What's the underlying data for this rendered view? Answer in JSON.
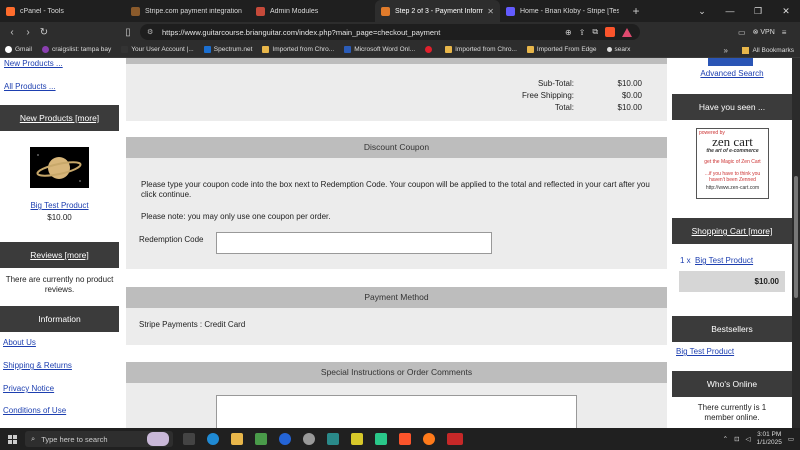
{
  "browser": {
    "tabs": [
      {
        "label": "cPanel - Tools",
        "color": "#ff6c2c"
      },
      {
        "label": "Stripe.com payment integration mo",
        "color": "#8a5a2b"
      },
      {
        "label": "Admin Modules",
        "color": "#c64a3a"
      },
      {
        "label": "Step 2 of 3 - Payment Informati",
        "color": "#e07b2b"
      },
      {
        "label": "Home - Brian Kloby - Stripe [Test]",
        "color": "#635bff"
      }
    ],
    "new_tab": "+",
    "url": "https://www.guitarcourse.brianguitar.com/index.php?main_page=checkout_payment",
    "vpn": "VPN",
    "bookmarks": [
      "Gmail",
      "craigslist: tampa bay",
      "Your User Account |...",
      "Spectrum.net",
      "Imported from Chro...",
      "Microsoft Word Onl...",
      "Imported from Chro...",
      "Imported From Edge",
      "searx"
    ],
    "bookmark_more": "»",
    "all_bookmarks": "All Bookmarks"
  },
  "left_sidebar": {
    "link_new_products": "New Products ...",
    "link_all_products": "All Products ...",
    "new_products_header": "New Products  [more]",
    "product_name": "Big Test Product",
    "product_price": "$10.00",
    "reviews_header": "Reviews  [more]",
    "reviews_text": "There are currently no product reviews.",
    "information_header": "Information",
    "info_links": [
      "About Us",
      "Shipping & Returns",
      "Privacy Notice",
      "Conditions of Use"
    ]
  },
  "center": {
    "totals": [
      {
        "label": "Sub-Total:",
        "value": "$10.00"
      },
      {
        "label": "Free Shipping:",
        "value": "$0.00"
      },
      {
        "label": "Total:",
        "value": "$10.00"
      }
    ],
    "coupon_header": "Discount Coupon",
    "coupon_instructions": "Please type your coupon code into the box next to Redemption Code. Your coupon will be applied to the total and reflected in your cart after you click continue.",
    "coupon_note": "Please note: you may only use one coupon per order.",
    "redemption_label": "Redemption Code",
    "redemption_value": "",
    "payment_header": "Payment Method",
    "payment_method": "Stripe Payments : Credit Card",
    "instructions_header": "Special Instructions or Order Comments",
    "comments_value": ""
  },
  "right_sidebar": {
    "advanced_search": "Advanced Search",
    "have_you_seen_header": "Have you seen ...",
    "zencart": {
      "powered_by": "powered by",
      "brand": "zen cart",
      "tagline": "the art of e-commerce",
      "magic": "get the Magic of Zen Cart",
      "zenned": "...if you have to think you haven't been Zenned",
      "url": "http://www.zen-cart.com"
    },
    "cart_header": "Shopping Cart  [more]",
    "cart_qty": "1 x",
    "cart_item": "Big Test Product",
    "cart_total": "$10.00",
    "bestsellers_header": "Bestsellers",
    "bestseller_item": "Big Test Product",
    "whos_online_header": "Who's Online",
    "whos_online_text": "There currently is 1 member online."
  },
  "taskbar": {
    "search_placeholder": "Type here to search",
    "time": "3:01 PM",
    "date": "1/1/2025"
  }
}
